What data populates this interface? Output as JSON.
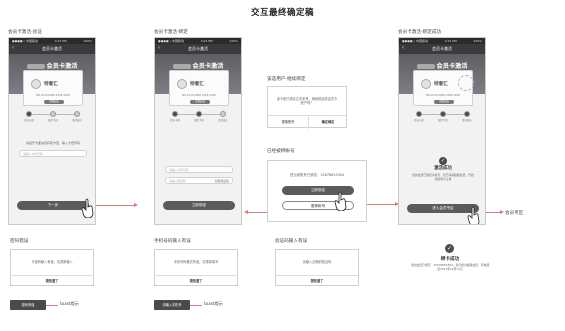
{
  "page_title": "交互最终确定稿",
  "status_bar": {
    "carrier": "●●●●○ 中国移动",
    "time": "4:21 PM",
    "battery": "100%"
  },
  "nav": {
    "back_icon": "chevron-left-icon",
    "title": "会员卡激活"
  },
  "hero": {
    "title": "会员卡激活",
    "subtitle": "升级超级会员，尊享会员8大特权"
  },
  "card": {
    "brand": "特奢汇",
    "number": "NO.1010 0000 2356 3246",
    "button": "查看权益"
  },
  "steps": [
    "验证卡密",
    "绑定手机",
    "激活成功"
  ],
  "screens": {
    "s1": {
      "label": "会员卡激活-验证",
      "hint": "请刮开卡面涂层获取卡密，输入卡密号码",
      "input_placeholder": "请输入卡密号码",
      "button": "下一步"
    },
    "s2": {
      "label": "会员卡激活-绑定",
      "phone_placeholder": "请输入手机号码",
      "code_placeholder": "请输入验证码",
      "code_button": "获取验证码",
      "button": "立即绑定"
    },
    "s3": {
      "label": "会员卡激活-绑定成功",
      "success_title": "激活成功",
      "success_text": "您的会员已绑定手机号，您已获得超级会员，开启您的奢享之旅",
      "button": "进入会员专区",
      "side_note": "会员专区"
    }
  },
  "registered": {
    "label": "该选用户-继续绑定",
    "text": "该卡密已绑定过手机号，继续绑定原会员卡账户吗？",
    "cancel": "更换账号",
    "confirm": "确定绑定"
  },
  "bound": {
    "label": "已经被绑帐号",
    "text": "您当前账号已绑定：15678653304",
    "primary": "立即绑定",
    "secondary": "更换帐号"
  },
  "errors": [
    {
      "label": "密码错误",
      "message": "卡密码输入有误，请重新输入",
      "ok": "我知道了",
      "toast": "密码有误",
      "toast_note": "toast提示"
    },
    {
      "label": "手机号码输入有误",
      "message": "手机号码格式有误，请重新填写",
      "ok": "我知道了",
      "toast": "请输入手机号",
      "toast_note": "toast提示"
    },
    {
      "label": "验证码输入有误",
      "message": "请输入正确的验证码",
      "ok": "我知道了"
    }
  ],
  "final": {
    "title": "绑卡成功",
    "text": "您的会员已绑定：15678653304，您已成为超级会员，有效期至2017年12月31日"
  },
  "colors": {
    "accent": "#5a5b5f",
    "nav": "#3a3a3a",
    "arrow": "#d97a7a",
    "highlight": "#d64545"
  }
}
